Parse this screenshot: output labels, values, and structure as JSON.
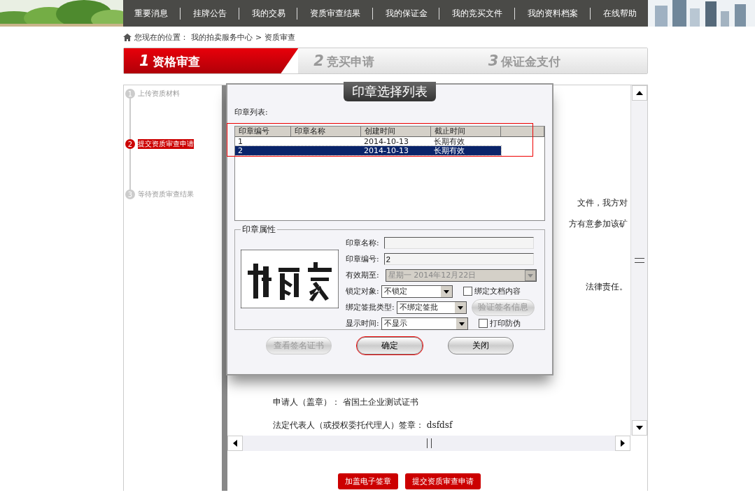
{
  "nav": {
    "items": [
      {
        "label": "重要消息"
      },
      {
        "label": "挂牌公告"
      },
      {
        "label": "我的交易"
      },
      {
        "label": "资质审查结果"
      },
      {
        "label": "我的保证金"
      },
      {
        "label": "我的竞买文件"
      },
      {
        "label": "我的资料档案"
      },
      {
        "label": "在线帮助"
      }
    ]
  },
  "breadcrumb": {
    "prefix": "您现在的位置：",
    "path": "我的拍卖服务中心",
    "sep": ">",
    "current": "资质审查"
  },
  "steps": [
    {
      "number": "1",
      "label": "资格审查",
      "selected": true
    },
    {
      "number": "2",
      "label": "竞买申请",
      "selected": false
    },
    {
      "number": "3",
      "label": "保证金支付",
      "selected": false
    }
  ],
  "sidebar": {
    "items": [
      {
        "number": "1",
        "label": "上传资质材料",
        "selected": false
      },
      {
        "number": "2",
        "label": "提交资质审查申请",
        "selected": true
      },
      {
        "number": "3",
        "label": "等待资质审查结果",
        "selected": false
      }
    ]
  },
  "document": {
    "fragments": [
      "文件，我方对",
      "方有意参加该矿",
      "法律责任。"
    ],
    "lines": [
      "申请人（盖章）： 省国土企业测试证书",
      "法定代表人（或授权委托代理人）签章： dsfdsf"
    ]
  },
  "dialog": {
    "title": "印章选择列表",
    "list_label": "印章列表:",
    "columns": [
      "印章编号",
      "印章名称",
      "创建时间",
      "截止时间"
    ],
    "rows": [
      {
        "cells": [
          "1",
          "",
          "2014-10-13",
          "长期有效"
        ],
        "selected": false
      },
      {
        "cells": [
          "2",
          "",
          "2014-10-13",
          "长期有效"
        ],
        "selected": true
      }
    ],
    "props_title": "印章属性",
    "name_label": "印章名称:",
    "number_label": "印章编号:",
    "number_value": "2",
    "expiry_label": "有效期至:",
    "expiry_value": "星期一 2014年12月22日",
    "lock_label": "锁定对象:",
    "lock_value": "不锁定",
    "bind_doc": {
      "label": "绑定文档内容",
      "checked": false
    },
    "sign_type_label": "绑定签批类型:",
    "sign_type_value": "不绑定签批",
    "verify_button": "验证签名信息",
    "time_label": "显示时间:",
    "time_value": "不显示",
    "anti_fake": {
      "label": "打印防伪",
      "checked": false
    },
    "buttons": [
      {
        "label": "查看签名证书",
        "disabled": true
      },
      {
        "label": "确定",
        "disabled": false
      },
      {
        "label": "关闭",
        "disabled": false
      }
    ]
  },
  "actions": [
    "加盖电子签章",
    "提交资质审查申请"
  ]
}
